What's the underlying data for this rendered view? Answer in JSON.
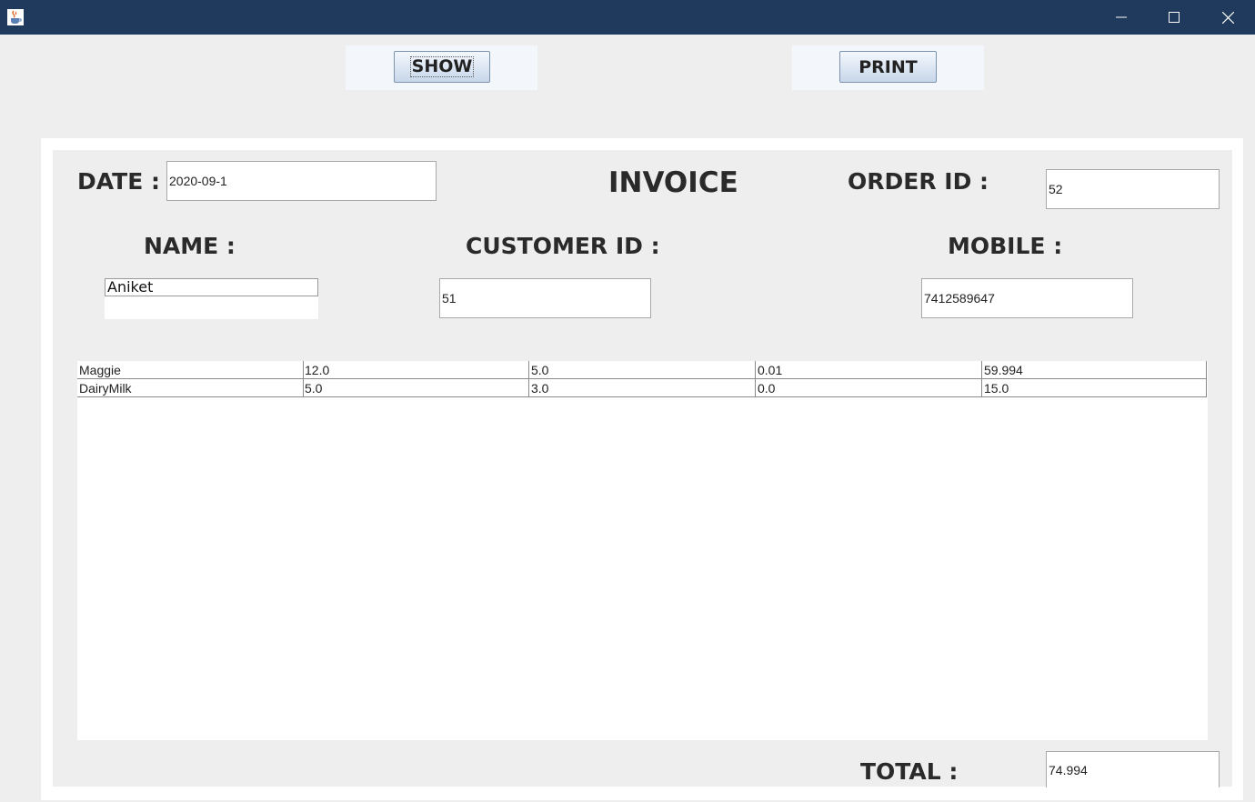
{
  "toolbar": {
    "show_label": "SHOW",
    "print_label": "PRINT"
  },
  "invoice": {
    "heading": "INVOICE",
    "date_label": "DATE :",
    "date_value": "2020-09-1",
    "order_id_label": "ORDER ID :",
    "order_id_value": "52",
    "name_label": "NAME  :",
    "name_value": "Aniket",
    "customer_id_label": "CUSTOMER ID :",
    "customer_id_value": "51",
    "mobile_label": "MOBILE :",
    "mobile_value": "7412589647",
    "total_label": "TOTAL  :",
    "total_value": "74.994"
  },
  "items": [
    [
      "Maggie",
      "12.0",
      "5.0",
      "0.01",
      "59.994"
    ],
    [
      "DairyMilk",
      "5.0",
      "3.0",
      "0.0",
      "15.0"
    ]
  ],
  "icons": {
    "app": "java-cup-icon",
    "minimize": "minimize-icon",
    "maximize": "maximize-icon",
    "close": "close-icon"
  }
}
